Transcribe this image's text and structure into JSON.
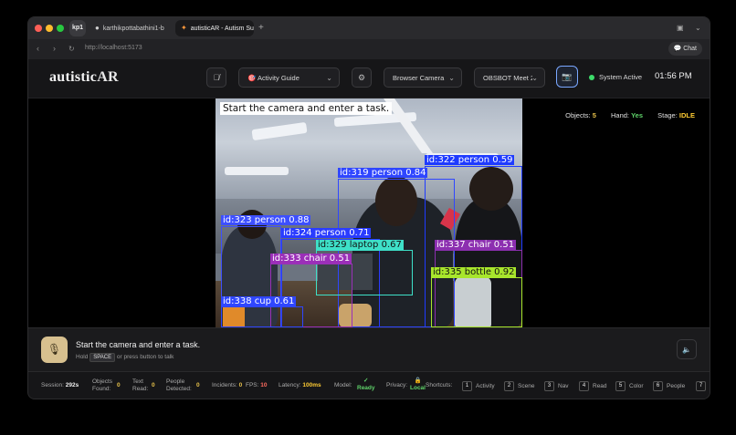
{
  "browser": {
    "tabs": [
      {
        "label": "kp1"
      },
      {
        "label": "karthikpottabathini1-b"
      },
      {
        "label": "autisticAR - Autism Su"
      }
    ],
    "new_tab": "+",
    "url": "http://localhost:5173",
    "chat_label": "Chat"
  },
  "header": {
    "logo_main": "autistic",
    "logo_ar": "AR",
    "mode_select": "Activity Guide",
    "mode_icon": "🎯",
    "camera_source": "Browser Camera",
    "device_select": "OBSBOT Meet 2",
    "status": "System Active",
    "time": "01:56 PM"
  },
  "stage_stats": {
    "objects_label": "Objects:",
    "objects_value": "5",
    "hand_label": "Hand:",
    "hand_value": "Yes",
    "stage_label": "Stage:",
    "stage_value": "IDLE"
  },
  "camera": {
    "overlay_text": "Start the camera and enter a task.",
    "detections": [
      {
        "label": "id:322 person 0.59",
        "color": "#1f3bff"
      },
      {
        "label": "id:319 person 0.84",
        "color": "#2f46ff"
      },
      {
        "label": "id:323 person 0.88",
        "color": "#3d4fff"
      },
      {
        "label": "id:324 person 0.71",
        "color": "#2a3cff"
      },
      {
        "label": "id:329 laptop 0.67",
        "color": "#3ee0c8"
      },
      {
        "label": "id:337 chair 0.51",
        "color": "#8c2fb0"
      },
      {
        "label": "id:333 chair 0.51",
        "color": "#9b2fb8"
      },
      {
        "label": "id:335 bottle 0.92",
        "color": "#a8e62c"
      },
      {
        "label": "id:338 cup 0.61",
        "color": "#2f46ff"
      }
    ]
  },
  "prompt": {
    "title": "Start the camera and enter a task.",
    "hint_prefix": "Hold",
    "hint_key": "SPACE",
    "hint_suffix": "or press button to talk"
  },
  "footer": {
    "session_label": "Session:",
    "session_value": "292s",
    "objects_label": "Objects\nFound:",
    "objects_l1": "Objects",
    "objects_l2": "Found:",
    "objects_value": "0",
    "text_l1": "Text",
    "text_l2": "Read:",
    "text_value": "0",
    "people_l1": "People",
    "people_l2": "Detected:",
    "people_value": "0",
    "incidents_label": "Incidents:",
    "incidents_value": "0",
    "fps_label": "FPS:",
    "fps_value": "10",
    "latency_label": "Latency:",
    "latency_value": "100ms",
    "model_label": "Model:",
    "model_value": "Ready",
    "model_check": "✓",
    "privacy_label": "Privacy:",
    "privacy_value": "Local",
    "privacy_icon": "🔒",
    "shortcuts_label": "Shortcuts:",
    "shortcuts": [
      {
        "key": "1",
        "label": "Activity"
      },
      {
        "key": "2",
        "label": "Scene"
      },
      {
        "key": "3",
        "label": "Nav"
      },
      {
        "key": "4",
        "label": "Read"
      },
      {
        "key": "5",
        "label": "Color"
      },
      {
        "key": "6",
        "label": "People"
      },
      {
        "key": "7",
        "label": ""
      }
    ]
  },
  "colors": {
    "accent_status": "#3ddc6a",
    "mic_button": "#d7c08f",
    "objects_value": "#e6c04a",
    "hand_value": "#5fd36a",
    "stage_value": "#ffcc33"
  }
}
